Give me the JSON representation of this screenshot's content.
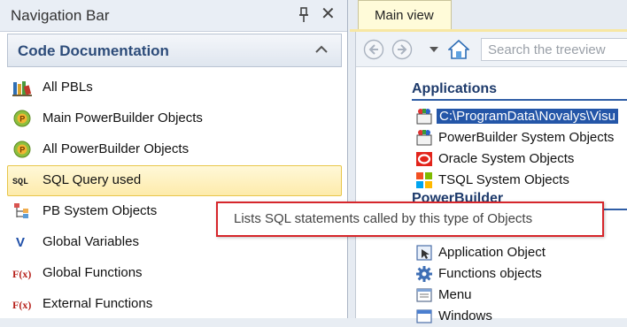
{
  "nav": {
    "title": "Navigation Bar",
    "group_title": "Code Documentation",
    "items": [
      {
        "label": "All PBLs",
        "icon": "books-icon"
      },
      {
        "label": "Main PowerBuilder Objects",
        "icon": "powerbuilder-icon"
      },
      {
        "label": "All PowerBuilder Objects",
        "icon": "powerbuilder-icon"
      },
      {
        "label": "SQL Query used",
        "icon": "sql-icon",
        "selected": true
      },
      {
        "label": "PB System Objects",
        "icon": "hierarchy-icon"
      },
      {
        "label": "Global Variables",
        "icon": "variable-icon"
      },
      {
        "label": "Global Functions",
        "icon": "function-icon"
      },
      {
        "label": "External Functions",
        "icon": "function-icon"
      }
    ],
    "sql_icon_text": "SQL",
    "var_icon_text": "V",
    "fx_icon_text": "F(x)"
  },
  "main": {
    "tab_label": "Main view",
    "search_placeholder": "Search the treeview",
    "sections": [
      {
        "heading": "Applications",
        "items": [
          {
            "label": "C:\\ProgramData\\Novalys\\Visu",
            "icon": "app-objects-icon",
            "selected": true
          },
          {
            "label": "PowerBuilder System Objects",
            "icon": "app-objects-icon"
          },
          {
            "label": "Oracle System Objects",
            "icon": "oracle-icon"
          },
          {
            "label": "TSQL System Objects",
            "icon": "tsql-icon"
          }
        ]
      },
      {
        "heading": "PowerBuilder",
        "items": [
          {
            "label": "Application Object",
            "icon": "application-object-icon"
          },
          {
            "label": "Functions objects",
            "icon": "gear-icon"
          },
          {
            "label": "Menu",
            "icon": "menu-icon"
          },
          {
            "label": "Windows",
            "icon": "window-icon"
          }
        ]
      }
    ]
  },
  "tooltip": {
    "text": "Lists SQL statements called by this type of Objects"
  },
  "colors": {
    "accent_blue": "#2456a8",
    "selection_yellow": "#fdebab",
    "tooltip_border": "#d6262b",
    "group_title": "#2d4c7a"
  }
}
